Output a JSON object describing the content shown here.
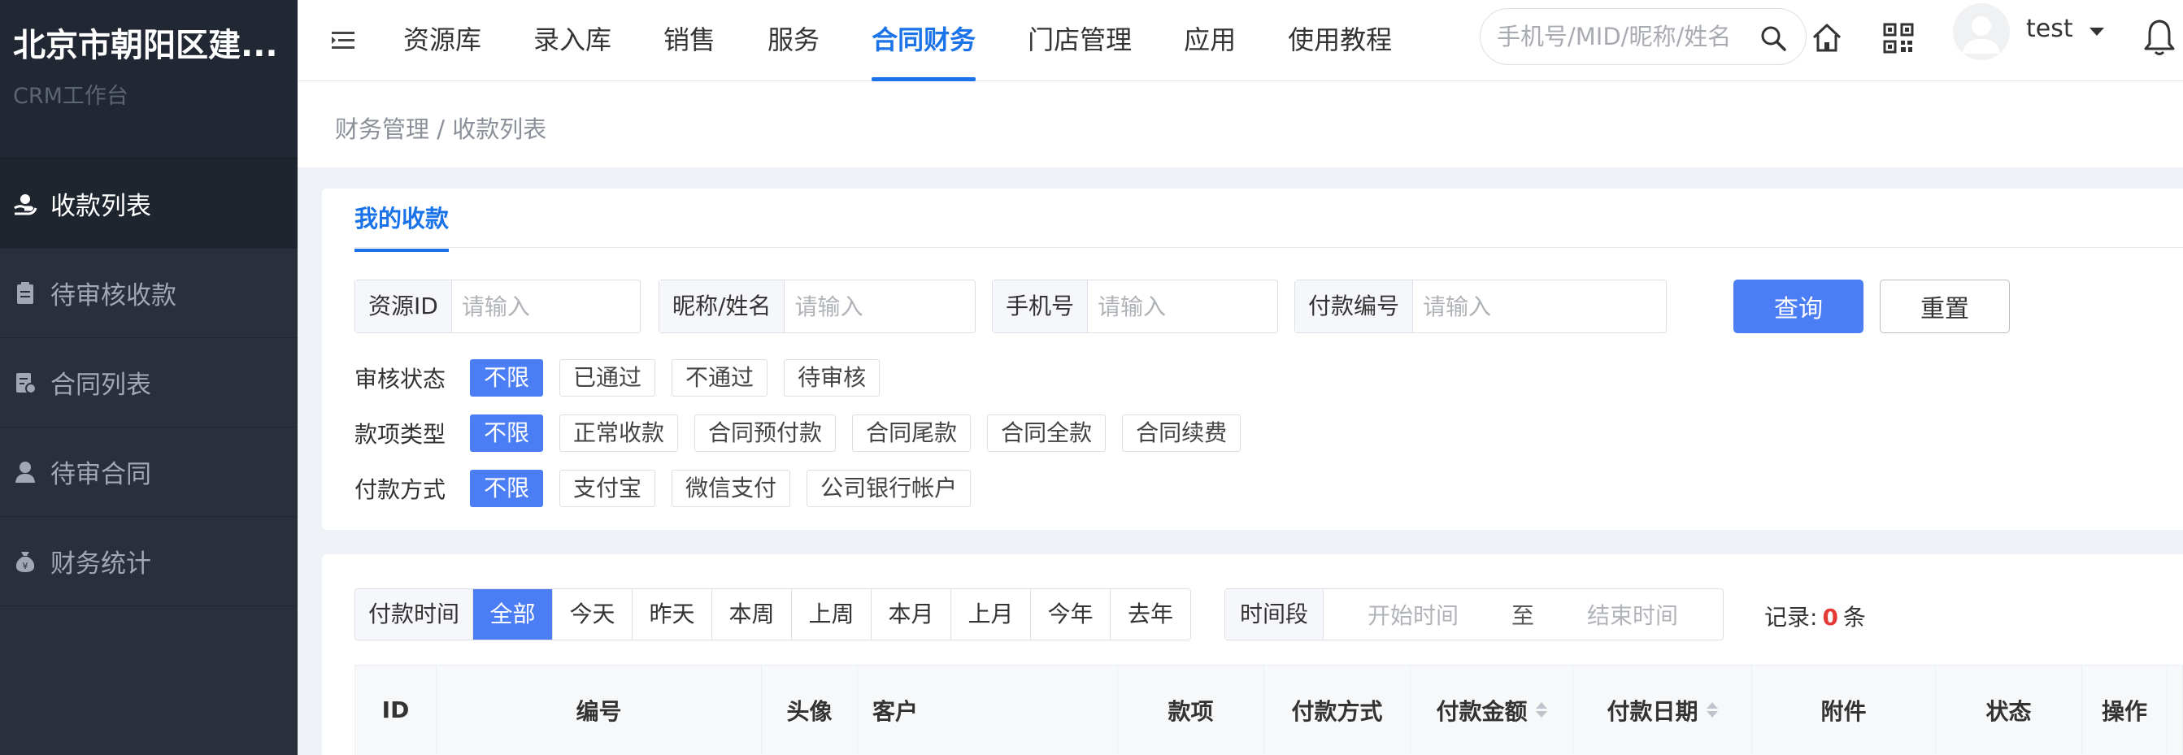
{
  "sidebar": {
    "brand_title": "北京市朝阳区建...",
    "brand_subtitle": "CRM工作台",
    "items": [
      {
        "label": "收款列表",
        "icon": "hand-money-icon",
        "active": true
      },
      {
        "label": "待审核收款",
        "icon": "clipboard-icon",
        "active": false
      },
      {
        "label": "合同列表",
        "icon": "contract-icon",
        "active": false
      },
      {
        "label": "待审合同",
        "icon": "user-icon",
        "active": false
      },
      {
        "label": "财务统计",
        "icon": "money-bag-icon",
        "active": false
      }
    ]
  },
  "topnav": {
    "items": [
      "资源库",
      "录入库",
      "销售",
      "服务",
      "合同财务",
      "门店管理",
      "应用",
      "使用教程"
    ],
    "active_index": 4,
    "search_placeholder": "手机号/MID/昵称/姓名",
    "username": "test"
  },
  "breadcrumb": "财务管理 / 收款列表",
  "filter": {
    "tab": "我的收款",
    "fields": [
      {
        "label": "资源ID",
        "placeholder": "请输入",
        "value": ""
      },
      {
        "label": "昵称/姓名",
        "placeholder": "请输入",
        "value": ""
      },
      {
        "label": "手机号",
        "placeholder": "请输入",
        "value": ""
      },
      {
        "label": "付款编号",
        "placeholder": "请输入",
        "value": ""
      }
    ],
    "query_label": "查询",
    "reset_label": "重置",
    "audit_status": {
      "label": "审核状态",
      "options": [
        "不限",
        "已通过",
        "不通过",
        "待审核"
      ],
      "selected": 0
    },
    "payment_type": {
      "label": "款项类型",
      "options": [
        "不限",
        "正常收款",
        "合同预付款",
        "合同尾款",
        "合同全款",
        "合同续费"
      ],
      "selected": 0
    },
    "payment_method": {
      "label": "付款方式",
      "options": [
        "不限",
        "支付宝",
        "微信支付",
        "公司银行帐户"
      ],
      "selected": 0
    }
  },
  "table": {
    "time_label": "付款时间",
    "time_options": [
      "全部",
      "今天",
      "昨天",
      "本周",
      "上周",
      "本月",
      "上月",
      "今年",
      "去年"
    ],
    "time_selected": 0,
    "range_label": "时间段",
    "range_start_placeholder": "开始时间",
    "range_sep": "至",
    "range_end_placeholder": "结束时间",
    "records_label": "记录:",
    "records_count": "0",
    "records_unit": "条",
    "columns": [
      "ID",
      "编号",
      "头像",
      "客户",
      "款项",
      "付款方式",
      "付款金额",
      "付款日期",
      "附件",
      "状态",
      "操作"
    ]
  },
  "colors": {
    "accent": "#1a73e8",
    "button_primary": "#4b7ef5",
    "sidebar_bg": "#29303c",
    "record_count": "#e53935"
  }
}
